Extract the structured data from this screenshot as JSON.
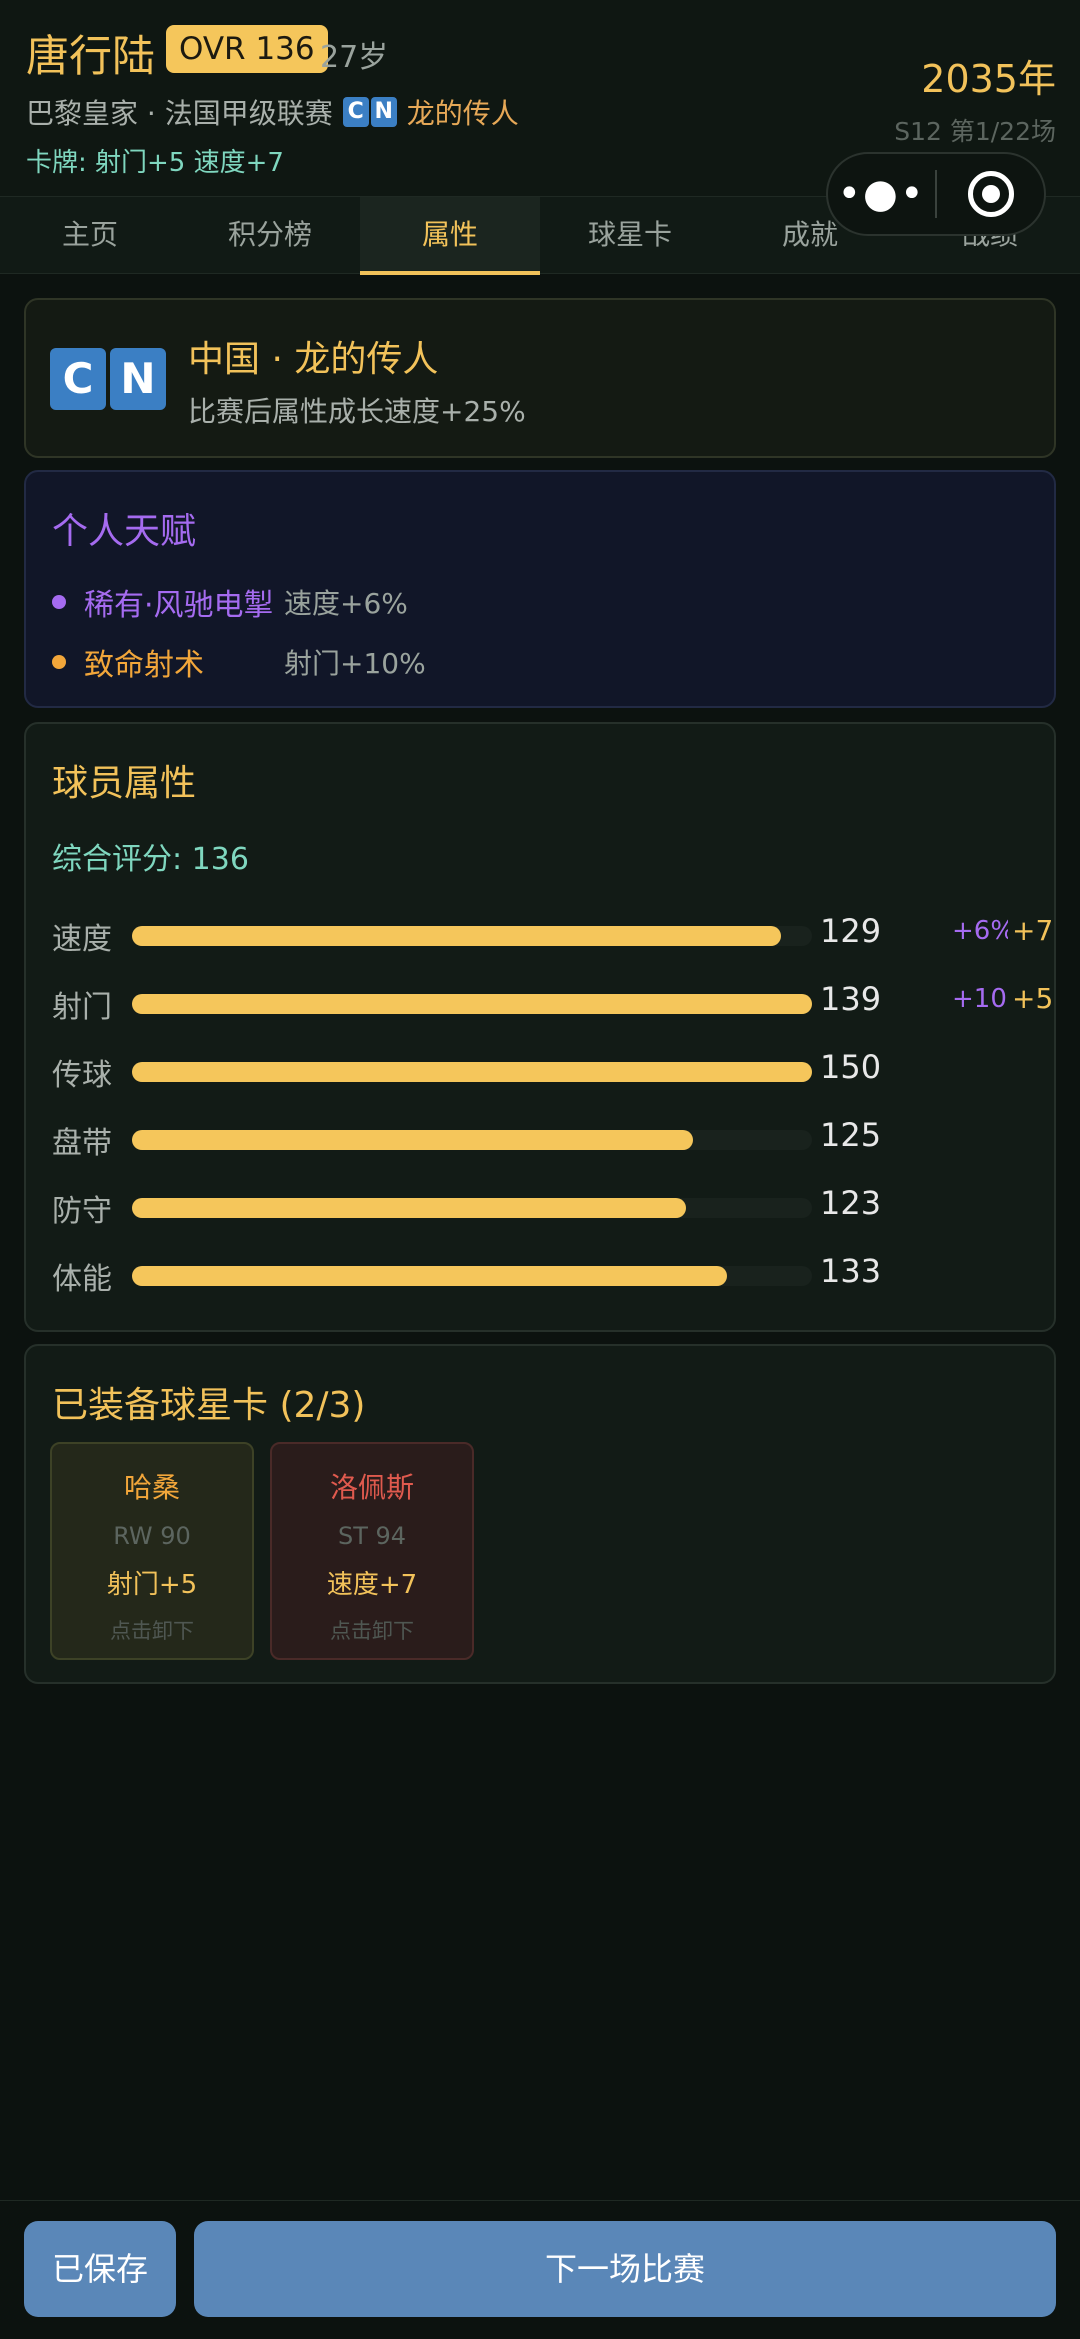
{
  "header": {
    "player_name": "唐行陆",
    "ovr_badge": "OVR 136",
    "age": "27岁",
    "club_league": "巴黎皇家 · 法国甲级联赛",
    "flag_letters": [
      "C",
      "N"
    ],
    "nation_title": "龙的传人",
    "cards_line": "卡牌: 射门+5 速度+7",
    "year": "2035年",
    "season_progress": "S12 第1/22场"
  },
  "capsule": {
    "more_icon": "more-dots-icon",
    "close_icon": "target-circle-icon"
  },
  "tabs": [
    {
      "label": "主页",
      "active": false
    },
    {
      "label": "积分榜",
      "active": false
    },
    {
      "label": "属性",
      "active": true
    },
    {
      "label": "球星卡",
      "active": false
    },
    {
      "label": "成就",
      "active": false
    },
    {
      "label": "战绩",
      "active": false
    }
  ],
  "nation_panel": {
    "title": "中国 · 龙的传人",
    "description": "比赛后属性成长速度+25%"
  },
  "talent_panel": {
    "title": "个人天赋",
    "items": [
      {
        "name": "稀有·风驰电掣",
        "effect": "速度+6%",
        "color": "#a56bf0"
      },
      {
        "name": "致命射术",
        "effect": "射门+10%",
        "color": "#f2a63a"
      }
    ]
  },
  "attributes_panel": {
    "title": "球员属性",
    "overall": "综合评分: 136",
    "rows": [
      {
        "label": "速度",
        "value": "129",
        "fill": 0.955,
        "bonus": "+6%",
        "plus": "+7"
      },
      {
        "label": "射门",
        "value": "139",
        "fill": 1.0,
        "bonus": "+10%",
        "plus": "+5"
      },
      {
        "label": "传球",
        "value": "150",
        "fill": 1.0,
        "bonus": "",
        "plus": ""
      },
      {
        "label": "盘带",
        "value": "125",
        "fill": 0.825,
        "bonus": "",
        "plus": ""
      },
      {
        "label": "防守",
        "value": "123",
        "fill": 0.815,
        "bonus": "",
        "plus": ""
      },
      {
        "label": "体能",
        "value": "133",
        "fill": 0.875,
        "bonus": "",
        "plus": ""
      }
    ]
  },
  "equipped_panel": {
    "title": "已装备球星卡 (2/3)",
    "cards": [
      {
        "name": "哈桑",
        "position": "RW 90",
        "buff": "射门+5",
        "hint": "点击卸下",
        "name_color": "#f2a63a"
      },
      {
        "name": "洛佩斯",
        "position": "ST 94",
        "buff": "速度+7",
        "hint": "点击卸下",
        "name_color": "#e05a4e"
      }
    ]
  },
  "bottom_bar": {
    "save_label": "已保存",
    "next_label": "下一场比赛"
  }
}
